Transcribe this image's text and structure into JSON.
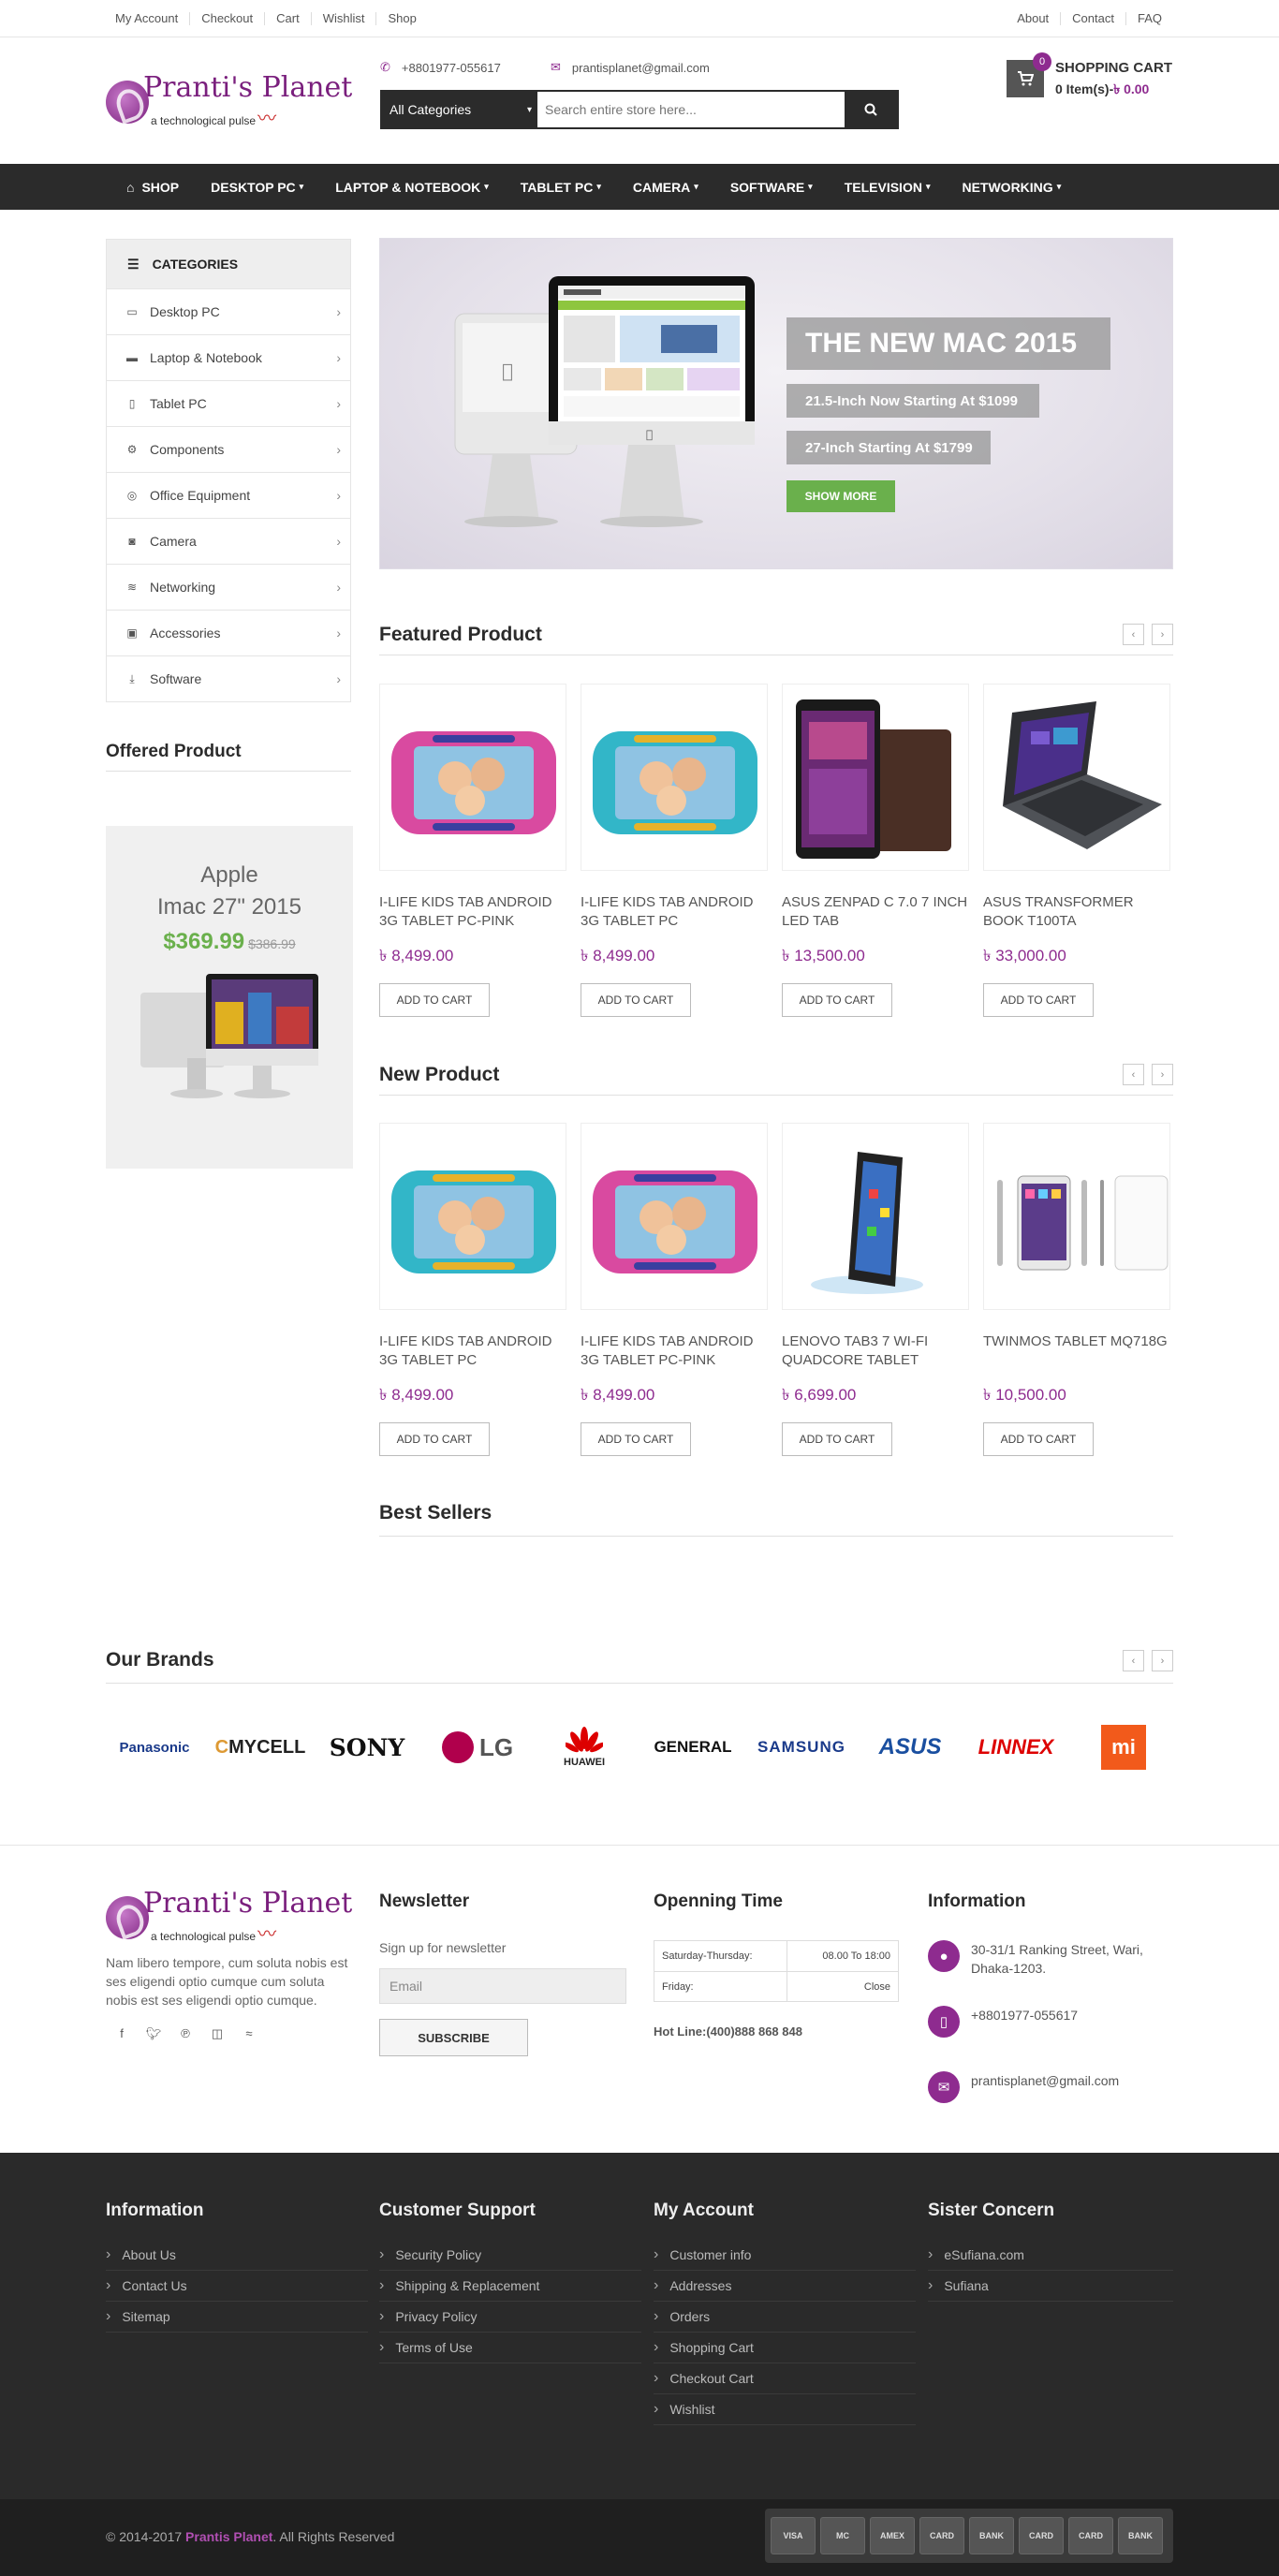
{
  "topbar": {
    "left_links": [
      "My Account",
      "Checkout",
      "Cart",
      "Wishlist",
      "Shop"
    ],
    "right_links": [
      "About",
      "Contact",
      "FAQ"
    ]
  },
  "logo": {
    "name": "Pranti's Planet",
    "tagline": "a technological pulse"
  },
  "header": {
    "phone": "+8801977-055617",
    "email": "prantisplanet@gmail.com",
    "search": {
      "category": "All Categories",
      "placeholder": "Search entire store here..."
    },
    "cart": {
      "title": "SHOPPING CART",
      "count": "0",
      "items_text": "0 Item(s)-",
      "amount": "৳ 0.00"
    }
  },
  "nav": [
    "SHOP",
    "DESKTOP PC",
    "LAPTOP & NOTEBOOK",
    "TABLET PC",
    "CAMERA",
    "SOFTWARE",
    "TELEVISION",
    "NETWORKING"
  ],
  "categories": {
    "title": "CATEGORIES",
    "items": [
      "Desktop PC",
      "Laptop & Notebook",
      "Tablet PC",
      "Components",
      "Office Equipment",
      "Camera",
      "Networking",
      "Accessories",
      "Software"
    ]
  },
  "offered": {
    "title": "Offered Product",
    "name_line1": "Apple",
    "name_line2": "Imac 27\" 2015",
    "price": "$369.99",
    "old_price": "$386.99"
  },
  "slider": {
    "title": "THE NEW MAC 2015",
    "line1": "21.5-Inch Now Starting At $1099",
    "line2": "27-Inch Starting At $1799",
    "button": "SHOW MORE"
  },
  "featured": {
    "title": "Featured Product",
    "products": [
      {
        "name": "I-LIFE KIDS TAB ANDROID 3G TABLET PC-PINK",
        "price": "৳ 8,499.00",
        "cta": "ADD TO CART"
      },
      {
        "name": "I-LIFE KIDS TAB ANDROID 3G TABLET PC",
        "price": "৳ 8,499.00",
        "cta": "ADD TO CART"
      },
      {
        "name": "ASUS ZENPAD C 7.0 7 INCH LED TAB",
        "price": "৳ 13,500.00",
        "cta": "ADD TO CART"
      },
      {
        "name": "ASUS TRANSFORMER BOOK T100TA",
        "price": "৳ 33,000.00",
        "cta": "ADD TO CART"
      }
    ]
  },
  "new_products": {
    "title": "New Product",
    "products": [
      {
        "name": "I-LIFE KIDS TAB ANDROID 3G TABLET PC",
        "price": "৳ 8,499.00",
        "cta": "ADD TO CART"
      },
      {
        "name": "I-LIFE KIDS TAB ANDROID 3G TABLET PC-PINK",
        "price": "৳ 8,499.00",
        "cta": "ADD TO CART"
      },
      {
        "name": "LENOVO TAB3 7 WI-FI QUADCORE TABLET",
        "price": "৳ 6,699.00",
        "cta": "ADD TO CART"
      },
      {
        "name": "TWINMOS TABLET MQ718G",
        "price": "৳ 10,500.00",
        "cta": "ADD TO CART"
      }
    ]
  },
  "best_sellers": {
    "title": "Best Sellers"
  },
  "brands": {
    "title": "Our Brands",
    "items": [
      "Panasonic",
      "MYCELL",
      "SONY",
      "LG",
      "HUAWEI",
      "GENERAL",
      "SAMSUNG",
      "ASUS",
      "LINNEX",
      "mi"
    ]
  },
  "footer": {
    "about": "Nam libero tempore, cum soluta nobis est ses eligendi optio cumque cum soluta nobis est ses eligendi optio cumque.",
    "newsletter": {
      "title": "Newsletter",
      "label": "Sign up for newsletter",
      "placeholder": "Email",
      "button": "SUBSCRIBE"
    },
    "opening": {
      "title": "Openning Time",
      "rows": [
        {
          "day": "Saturday-Thursday:",
          "time": "08.00 To 18:00"
        },
        {
          "day": "Friday:",
          "time": "Close"
        }
      ],
      "hotline": "Hot Line:(400)888 868 848"
    },
    "information": {
      "title": "Information",
      "address": "30-31/1 Ranking Street, Wari, Dhaka-1203.",
      "phone": "+8801977-055617",
      "email": "prantisplanet@gmail.com"
    }
  },
  "dark_footer": {
    "columns": [
      {
        "title": "Information",
        "links": [
          "About Us",
          "Contact Us",
          "Sitemap"
        ]
      },
      {
        "title": "Customer Support",
        "links": [
          "Security Policy",
          "Shipping & Replacement",
          "Privacy Policy",
          "Terms of Use"
        ]
      },
      {
        "title": "My Account",
        "links": [
          "Customer info",
          "Addresses",
          "Orders",
          "Shopping Cart",
          "Checkout Cart",
          "Wishlist"
        ]
      },
      {
        "title": "Sister Concern",
        "links": [
          "eSufiana.com",
          "Sufiana"
        ]
      }
    ]
  },
  "bottom": {
    "copyright_prefix": "© 2014-2017 ",
    "brand": "Prantis Planet",
    "copyright_suffix": ". All Rights Reserved",
    "payments": [
      "VISA",
      "MC",
      "AMEX",
      "CARD",
      "BANK",
      "CARD",
      "CARD",
      "BANK"
    ]
  }
}
